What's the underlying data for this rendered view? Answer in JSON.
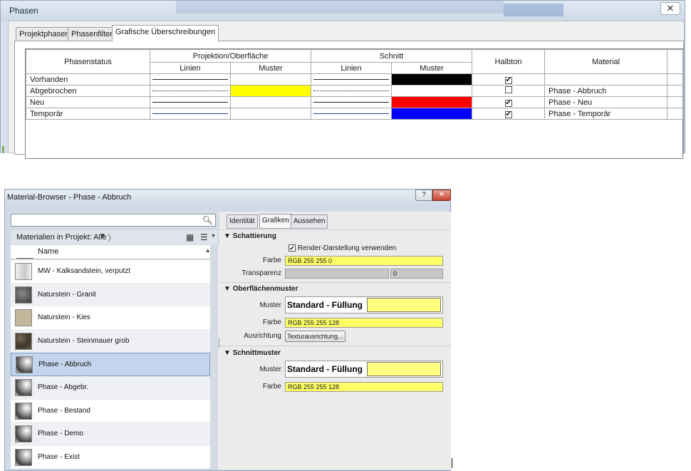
{
  "phasen": {
    "title": "Phasen",
    "close_label": "✕",
    "tabs": [
      {
        "label": "Projektphasen"
      },
      {
        "label": "Phasenfilter"
      },
      {
        "label": "Grafische Überschreibungen"
      }
    ],
    "table": {
      "headers": {
        "phasenstatus": "Phasenstatus",
        "projektion": "Projektion/Oberfläche",
        "schnitt": "Schnitt",
        "halbton": "Halbton",
        "material": "Material",
        "linien": "Linien",
        "muster": "Muster",
        "schnitt_linien": "Linien",
        "schnitt_muster": "Muster"
      },
      "rows": [
        {
          "name": "Vorhanden",
          "proj_line": "solid",
          "proj_fill": "#ffffff",
          "cut_line": "solid",
          "cut_fill": "#000000",
          "halbton": true,
          "material": ""
        },
        {
          "name": "Abgebrochen",
          "proj_line": "dotted",
          "proj_fill": "#ffff00",
          "cut_line": "dotted",
          "cut_fill": "#ffffff",
          "halbton": false,
          "material": "Phase - Abbruch"
        },
        {
          "name": "Neu",
          "proj_line": "solid",
          "proj_fill": "#ffffff",
          "cut_line": "solid",
          "cut_fill": "#ff0000",
          "halbton": true,
          "material": "Phase - Neu"
        },
        {
          "name": "Temporär",
          "proj_line": "blue",
          "proj_fill": "#ffffff",
          "cut_line": "blue",
          "cut_fill": "#0000ff",
          "halbton": true,
          "material": "Phase - Temporär"
        }
      ]
    }
  },
  "material_browser": {
    "title": "Material-Browser - Phase - Abbruch",
    "help_label": "?",
    "close_label": "✕",
    "search": {
      "value": "",
      "placeholder": ""
    },
    "filter_label": "Materialien in Projekt: Alle",
    "list_header": "Name",
    "materials": [
      {
        "name": "MW - Kalksandstein, verputzt",
        "thumb": "kalk"
      },
      {
        "name": "Naturstein - Granit",
        "thumb": "granit"
      },
      {
        "name": "Naturstein - Kies",
        "thumb": "kies"
      },
      {
        "name": "Naturstein - Steinmauer grob",
        "thumb": "stein"
      },
      {
        "name": "Phase - Abbruch",
        "thumb": "sphere",
        "selected": true
      },
      {
        "name": "Phase - Abgebr.",
        "thumb": "sphere"
      },
      {
        "name": "Phase - Bestand",
        "thumb": "sphere"
      },
      {
        "name": "Phase - Demo",
        "thumb": "sphere"
      },
      {
        "name": "Phase - Exist",
        "thumb": "sphere"
      }
    ],
    "tabs": [
      {
        "label": "Identität"
      },
      {
        "label": "Grafiken"
      },
      {
        "label": "Aussehen"
      }
    ],
    "active_tab": "Grafiken",
    "schattierung": {
      "heading": "Schattierung",
      "render_checkbox_label": "Render-Darstellung verwenden",
      "render_checked": true,
      "farbe_label": "Farbe",
      "farbe_value": "RGB 255 255 0",
      "transparenz_label": "Transparenz",
      "transparenz_value": "0"
    },
    "oberflaechenmuster": {
      "heading": "Oberflächenmuster",
      "muster_label": "Muster",
      "muster_value": "Standard - Füllung",
      "farbe_label": "Farbe",
      "farbe_value": "RGB 255 255 128",
      "ausrichtung_label": "Ausrichtung",
      "ausrichtung_button": "Texturausrichtung..."
    },
    "schnittmuster": {
      "heading": "Schnittmuster",
      "muster_label": "Muster",
      "muster_value": "Standard - Füllung",
      "farbe_label": "Farbe",
      "farbe_value": "RGB 255 255 128"
    }
  },
  "colors": {
    "highlight_yellow": "#ffff66",
    "pattern_yellow": "#ffff80",
    "selection_blue": "#c3d5ec"
  }
}
